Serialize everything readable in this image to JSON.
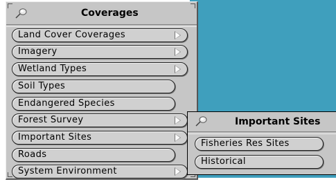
{
  "coverages_menu": {
    "title": "Coverages",
    "items": [
      {
        "label": "Land Cover Coverages",
        "submenu": true
      },
      {
        "label": "Imagery",
        "submenu": true
      },
      {
        "label": "Wetland Types",
        "submenu": true
      },
      {
        "label": "Soil Types",
        "submenu": false
      },
      {
        "label": "Endangered Species",
        "submenu": false
      },
      {
        "label": "Forest Survey",
        "submenu": true
      },
      {
        "label": "Important Sites",
        "submenu": true
      },
      {
        "label": "Roads",
        "submenu": false
      },
      {
        "label": "System Environment",
        "submenu": true
      }
    ]
  },
  "important_sites_menu": {
    "title": "Important Sites",
    "items": [
      {
        "label": "Fisheries Res Sites"
      },
      {
        "label": "Historical"
      }
    ]
  },
  "colors": {
    "menu_background": "#c6c6c6",
    "map_background": "#3f9fbd"
  },
  "icons": {
    "menu_pin": "pushpin-icon",
    "submenu_arrow": "submenu-arrow-icon"
  }
}
